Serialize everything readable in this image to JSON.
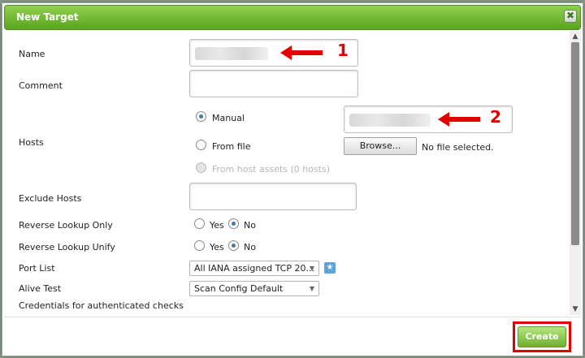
{
  "dialog": {
    "title": "New Target",
    "close_glyph": "✖"
  },
  "labels": {
    "name": "Name",
    "comment": "Comment",
    "hosts": "Hosts",
    "exclude_hosts": "Exclude Hosts",
    "reverse_lookup_only": "Reverse Lookup Only",
    "reverse_lookup_unify": "Reverse Lookup Unify",
    "port_list": "Port List",
    "alive_test": "Alive Test",
    "credentials": "Credentials for authenticated checks"
  },
  "hosts": {
    "manual": "Manual",
    "from_file": "From file",
    "from_host_assets": "From host assets (0 hosts)",
    "browse_label": "Browse...",
    "no_file": "No file selected."
  },
  "reverse_lookup_only": {
    "yes": "Yes",
    "no": "No",
    "selected": "No"
  },
  "reverse_lookup_unify": {
    "yes": "Yes",
    "no": "No",
    "selected": "No"
  },
  "port_list": {
    "selected": "All IANA assigned TCP 20..."
  },
  "alive_test": {
    "selected": "Scan Config Default"
  },
  "annotations": {
    "one": "1",
    "two": "2",
    "color": "#e00000"
  },
  "footer": {
    "create_label": "Create"
  }
}
